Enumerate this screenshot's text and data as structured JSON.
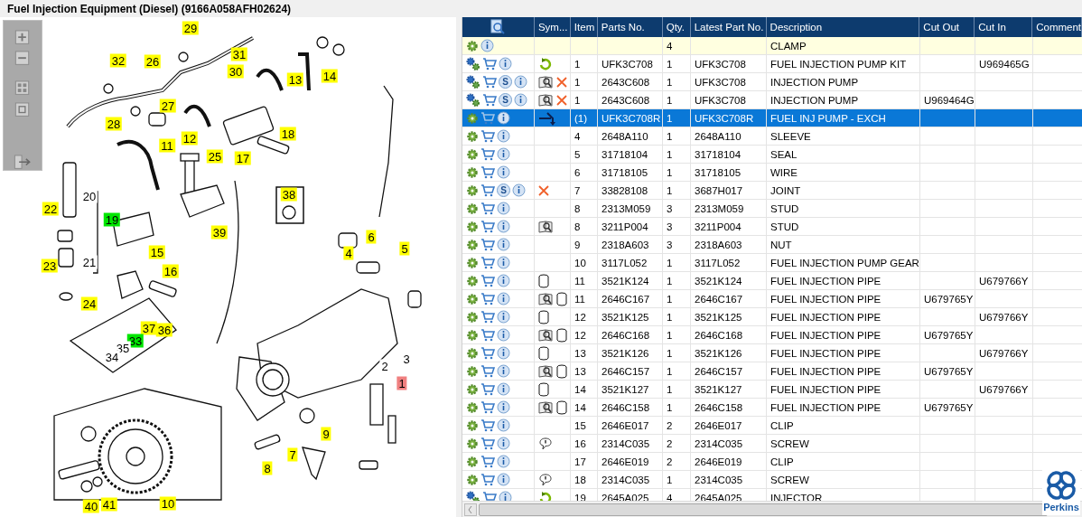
{
  "title": "Fuel Injection Equipment (Diesel) (9166A058AFH02624)",
  "callouts": [
    {
      "label": "29",
      "kind": "tag",
      "color": "#ffff00"
    },
    {
      "label": "32",
      "kind": "tag",
      "color": "#ffff00"
    },
    {
      "label": "26",
      "kind": "tag",
      "color": "#ffff00"
    },
    {
      "label": "31",
      "kind": "tag",
      "color": "#ffff00"
    },
    {
      "label": "30",
      "kind": "tag",
      "color": "#ffff00"
    },
    {
      "label": "13",
      "kind": "tag",
      "color": "#ffff00"
    },
    {
      "label": "14",
      "kind": "tag",
      "color": "#ffff00"
    },
    {
      "label": "27",
      "kind": "tag",
      "color": "#ffff00"
    },
    {
      "label": "28",
      "kind": "tag",
      "color": "#ffff00"
    },
    {
      "label": "12",
      "kind": "tag",
      "color": "#ffff00"
    },
    {
      "label": "11",
      "kind": "tag",
      "color": "#ffff00"
    },
    {
      "label": "18",
      "kind": "tag",
      "color": "#ffff00"
    },
    {
      "label": "17",
      "kind": "tag",
      "color": "#ffff00"
    },
    {
      "label": "25",
      "kind": "tag",
      "color": "#ffff00"
    },
    {
      "label": "38",
      "kind": "tag",
      "color": "#ffff00"
    },
    {
      "label": "20",
      "kind": "plain"
    },
    {
      "label": "22",
      "kind": "tag",
      "color": "#ffff00"
    },
    {
      "label": "19",
      "kind": "tag",
      "color": "#00e600"
    },
    {
      "label": "39",
      "kind": "tag",
      "color": "#ffff00"
    },
    {
      "label": "15",
      "kind": "tag",
      "color": "#ffff00"
    },
    {
      "label": "6",
      "kind": "tag",
      "color": "#ffff00"
    },
    {
      "label": "5",
      "kind": "tag",
      "color": "#ffff00"
    },
    {
      "label": "4",
      "kind": "tag",
      "color": "#ffff00"
    },
    {
      "label": "23",
      "kind": "tag",
      "color": "#ffff00"
    },
    {
      "label": "21",
      "kind": "plain"
    },
    {
      "label": "16",
      "kind": "tag",
      "color": "#ffff00"
    },
    {
      "label": "24",
      "kind": "tag",
      "color": "#ffff00"
    },
    {
      "label": "37",
      "kind": "tag",
      "color": "#ffff00"
    },
    {
      "label": "36",
      "kind": "tag",
      "color": "#ffff00"
    },
    {
      "label": "33",
      "kind": "tag",
      "color": "#00e600"
    },
    {
      "label": "35",
      "kind": "plain"
    },
    {
      "label": "34",
      "kind": "plain"
    },
    {
      "label": "2",
      "kind": "plain"
    },
    {
      "label": "3",
      "kind": "plain"
    },
    {
      "label": "1",
      "kind": "tag",
      "color": "#f08080"
    },
    {
      "label": "9",
      "kind": "tag",
      "color": "#ffff00"
    },
    {
      "label": "7",
      "kind": "tag",
      "color": "#ffff00"
    },
    {
      "label": "8",
      "kind": "tag",
      "color": "#ffff00"
    },
    {
      "label": "40",
      "kind": "tag",
      "color": "#ffff00"
    },
    {
      "label": "41",
      "kind": "tag",
      "color": "#ffff00"
    },
    {
      "label": "10",
      "kind": "tag",
      "color": "#ffff00"
    }
  ],
  "table": {
    "columns": [
      "Sym...",
      "Item",
      "Parts No.",
      "Qty.",
      "Latest Part No.",
      "Description",
      "Cut Out",
      "Cut In",
      "Comment"
    ],
    "rows": [
      {
        "actions": [
          {
            "kind": "gear"
          },
          {
            "kind": "info"
          }
        ],
        "symbols": [],
        "item": "",
        "parts_no": "",
        "qty": "4",
        "latest": "",
        "description": "CLAMP",
        "cut_out": "",
        "cut_in": "",
        "highlighted": true,
        "selected": false
      },
      {
        "actions": [
          {
            "kind": "gears"
          },
          {
            "kind": "cart"
          },
          {
            "kind": "info"
          }
        ],
        "symbols": [
          {
            "kind": "refresh"
          }
        ],
        "item": "1",
        "parts_no": "UFK3C708",
        "qty": "1",
        "latest": "UFK3C708",
        "description": "FUEL INJECTION PUMP KIT",
        "cut_out": "",
        "cut_in": "U969465G",
        "highlighted": false,
        "selected": false
      },
      {
        "actions": [
          {
            "kind": "gears"
          },
          {
            "kind": "cart"
          },
          {
            "kind": "badge",
            "label": "S"
          },
          {
            "kind": "info"
          }
        ],
        "symbols": [
          {
            "kind": "book"
          },
          {
            "kind": "cross"
          }
        ],
        "item": "1",
        "parts_no": "2643C608",
        "qty": "1",
        "latest": "UFK3C708",
        "description": "INJECTION PUMP",
        "cut_out": "",
        "cut_in": "",
        "highlighted": false,
        "selected": false
      },
      {
        "actions": [
          {
            "kind": "gears"
          },
          {
            "kind": "cart"
          },
          {
            "kind": "badge",
            "label": "S"
          },
          {
            "kind": "info"
          }
        ],
        "symbols": [
          {
            "kind": "book"
          },
          {
            "kind": "cross"
          }
        ],
        "item": "1",
        "parts_no": "2643C608",
        "qty": "1",
        "latest": "UFK3C708",
        "description": "INJECTION PUMP",
        "cut_out": "U969464G",
        "cut_in": "",
        "highlighted": false,
        "selected": false
      },
      {
        "actions": [
          {
            "kind": "gear"
          },
          {
            "kind": "cart"
          },
          {
            "kind": "info"
          }
        ],
        "symbols": [
          {
            "kind": "branch"
          }
        ],
        "item": "(1)",
        "parts_no": "UFK3C708R",
        "qty": "1",
        "latest": "UFK3C708R",
        "description": "FUEL INJ PUMP - EXCH",
        "cut_out": "",
        "cut_in": "",
        "highlighted": false,
        "selected": true
      },
      {
        "actions": [
          {
            "kind": "gear"
          },
          {
            "kind": "cart"
          },
          {
            "kind": "info"
          }
        ],
        "symbols": [],
        "item": "4",
        "parts_no": "2648A110",
        "qty": "1",
        "latest": "2648A110",
        "description": "SLEEVE",
        "cut_out": "",
        "cut_in": "",
        "highlighted": false,
        "selected": false
      },
      {
        "actions": [
          {
            "kind": "gear"
          },
          {
            "kind": "cart"
          },
          {
            "kind": "info"
          }
        ],
        "symbols": [],
        "item": "5",
        "parts_no": "31718104",
        "qty": "1",
        "latest": "31718104",
        "description": "SEAL",
        "cut_out": "",
        "cut_in": "",
        "highlighted": false,
        "selected": false
      },
      {
        "actions": [
          {
            "kind": "gear"
          },
          {
            "kind": "cart"
          },
          {
            "kind": "info"
          }
        ],
        "symbols": [],
        "item": "6",
        "parts_no": "31718105",
        "qty": "1",
        "latest": "31718105",
        "description": "WIRE",
        "cut_out": "",
        "cut_in": "",
        "highlighted": false,
        "selected": false
      },
      {
        "actions": [
          {
            "kind": "gear"
          },
          {
            "kind": "cart"
          },
          {
            "kind": "badge",
            "label": "S"
          },
          {
            "kind": "info"
          }
        ],
        "symbols": [
          {
            "kind": "cross"
          }
        ],
        "item": "7",
        "parts_no": "33828108",
        "qty": "1",
        "latest": "3687H017",
        "description": "JOINT",
        "cut_out": "",
        "cut_in": "",
        "highlighted": false,
        "selected": false
      },
      {
        "actions": [
          {
            "kind": "gear"
          },
          {
            "kind": "cart"
          },
          {
            "kind": "info"
          }
        ],
        "symbols": [],
        "item": "8",
        "parts_no": "2313M059",
        "qty": "3",
        "latest": "2313M059",
        "description": "STUD",
        "cut_out": "",
        "cut_in": "",
        "highlighted": false,
        "selected": false
      },
      {
        "actions": [
          {
            "kind": "gear"
          },
          {
            "kind": "cart"
          },
          {
            "kind": "info"
          }
        ],
        "symbols": [
          {
            "kind": "book"
          }
        ],
        "item": "8",
        "parts_no": "3211P004",
        "qty": "3",
        "latest": "3211P004",
        "description": "STUD",
        "cut_out": "",
        "cut_in": "",
        "highlighted": false,
        "selected": false
      },
      {
        "actions": [
          {
            "kind": "gear"
          },
          {
            "kind": "cart"
          },
          {
            "kind": "info"
          }
        ],
        "symbols": [],
        "item": "9",
        "parts_no": "2318A603",
        "qty": "3",
        "latest": "2318A603",
        "description": "NUT",
        "cut_out": "",
        "cut_in": "",
        "highlighted": false,
        "selected": false
      },
      {
        "actions": [
          {
            "kind": "gear"
          },
          {
            "kind": "cart"
          },
          {
            "kind": "info"
          }
        ],
        "symbols": [],
        "item": "10",
        "parts_no": "3117L052",
        "qty": "1",
        "latest": "3117L052",
        "description": "FUEL INJECTION PUMP GEAR",
        "cut_out": "",
        "cut_in": "",
        "highlighted": false,
        "selected": false
      },
      {
        "actions": [
          {
            "kind": "gear"
          },
          {
            "kind": "cart"
          },
          {
            "kind": "info"
          }
        ],
        "symbols": [
          {
            "kind": "cylinder"
          }
        ],
        "item": "11",
        "parts_no": "3521K124",
        "qty": "1",
        "latest": "3521K124",
        "description": "FUEL INJECTION PIPE",
        "cut_out": "",
        "cut_in": "U679766Y",
        "highlighted": false,
        "selected": false
      },
      {
        "actions": [
          {
            "kind": "gear"
          },
          {
            "kind": "cart"
          },
          {
            "kind": "info"
          }
        ],
        "symbols": [
          {
            "kind": "book"
          },
          {
            "kind": "cylinder"
          }
        ],
        "item": "11",
        "parts_no": "2646C167",
        "qty": "1",
        "latest": "2646C167",
        "description": "FUEL INJECTION PIPE",
        "cut_out": "U679765Y",
        "cut_in": "",
        "highlighted": false,
        "selected": false
      },
      {
        "actions": [
          {
            "kind": "gear"
          },
          {
            "kind": "cart"
          },
          {
            "kind": "info"
          }
        ],
        "symbols": [
          {
            "kind": "cylinder"
          }
        ],
        "item": "12",
        "parts_no": "3521K125",
        "qty": "1",
        "latest": "3521K125",
        "description": "FUEL INJECTION PIPE",
        "cut_out": "",
        "cut_in": "U679766Y",
        "highlighted": false,
        "selected": false
      },
      {
        "actions": [
          {
            "kind": "gear"
          },
          {
            "kind": "cart"
          },
          {
            "kind": "info"
          }
        ],
        "symbols": [
          {
            "kind": "book"
          },
          {
            "kind": "cylinder"
          }
        ],
        "item": "12",
        "parts_no": "2646C168",
        "qty": "1",
        "latest": "2646C168",
        "description": "FUEL INJECTION PIPE",
        "cut_out": "U679765Y",
        "cut_in": "",
        "highlighted": false,
        "selected": false
      },
      {
        "actions": [
          {
            "kind": "gear"
          },
          {
            "kind": "cart"
          },
          {
            "kind": "info"
          }
        ],
        "symbols": [
          {
            "kind": "cylinder"
          }
        ],
        "item": "13",
        "parts_no": "3521K126",
        "qty": "1",
        "latest": "3521K126",
        "description": "FUEL INJECTION PIPE",
        "cut_out": "",
        "cut_in": "U679766Y",
        "highlighted": false,
        "selected": false
      },
      {
        "actions": [
          {
            "kind": "gear"
          },
          {
            "kind": "cart"
          },
          {
            "kind": "info"
          }
        ],
        "symbols": [
          {
            "kind": "book"
          },
          {
            "kind": "cylinder"
          }
        ],
        "item": "13",
        "parts_no": "2646C157",
        "qty": "1",
        "latest": "2646C157",
        "description": "FUEL INJECTION PIPE",
        "cut_out": "U679765Y",
        "cut_in": "",
        "highlighted": false,
        "selected": false
      },
      {
        "actions": [
          {
            "kind": "gear"
          },
          {
            "kind": "cart"
          },
          {
            "kind": "info"
          }
        ],
        "symbols": [
          {
            "kind": "cylinder"
          }
        ],
        "item": "14",
        "parts_no": "3521K127",
        "qty": "1",
        "latest": "3521K127",
        "description": "FUEL INJECTION PIPE",
        "cut_out": "",
        "cut_in": "U679766Y",
        "highlighted": false,
        "selected": false
      },
      {
        "actions": [
          {
            "kind": "gear"
          },
          {
            "kind": "cart"
          },
          {
            "kind": "info"
          }
        ],
        "symbols": [
          {
            "kind": "book"
          },
          {
            "kind": "cylinder"
          }
        ],
        "item": "14",
        "parts_no": "2646C158",
        "qty": "1",
        "latest": "2646C158",
        "description": "FUEL INJECTION PIPE",
        "cut_out": "U679765Y",
        "cut_in": "",
        "highlighted": false,
        "selected": false
      },
      {
        "actions": [
          {
            "kind": "gear"
          },
          {
            "kind": "cart"
          },
          {
            "kind": "info"
          }
        ],
        "symbols": [],
        "item": "15",
        "parts_no": "2646E017",
        "qty": "2",
        "latest": "2646E017",
        "description": "CLIP",
        "cut_out": "",
        "cut_in": "",
        "highlighted": false,
        "selected": false
      },
      {
        "actions": [
          {
            "kind": "gear"
          },
          {
            "kind": "cart"
          },
          {
            "kind": "info"
          }
        ],
        "symbols": [
          {
            "kind": "speech"
          }
        ],
        "item": "16",
        "parts_no": "2314C035",
        "qty": "2",
        "latest": "2314C035",
        "description": "SCREW",
        "cut_out": "",
        "cut_in": "",
        "highlighted": false,
        "selected": false
      },
      {
        "actions": [
          {
            "kind": "gear"
          },
          {
            "kind": "cart"
          },
          {
            "kind": "info"
          }
        ],
        "symbols": [],
        "item": "17",
        "parts_no": "2646E019",
        "qty": "2",
        "latest": "2646E019",
        "description": "CLIP",
        "cut_out": "",
        "cut_in": "",
        "highlighted": false,
        "selected": false
      },
      {
        "actions": [
          {
            "kind": "gear"
          },
          {
            "kind": "cart"
          },
          {
            "kind": "info"
          }
        ],
        "symbols": [
          {
            "kind": "speech"
          }
        ],
        "item": "18",
        "parts_no": "2314C035",
        "qty": "1",
        "latest": "2314C035",
        "description": "SCREW",
        "cut_out": "",
        "cut_in": "",
        "highlighted": false,
        "selected": false
      },
      {
        "actions": [
          {
            "kind": "gears"
          },
          {
            "kind": "cart"
          },
          {
            "kind": "info"
          }
        ],
        "symbols": [
          {
            "kind": "refresh"
          }
        ],
        "item": "19",
        "parts_no": "2645A025",
        "qty": "4",
        "latest": "2645A025",
        "description": "INJECTOR",
        "cut_out": "",
        "cut_in": "",
        "highlighted": false,
        "selected": false
      }
    ]
  },
  "logo": {
    "text": "Perkins"
  }
}
